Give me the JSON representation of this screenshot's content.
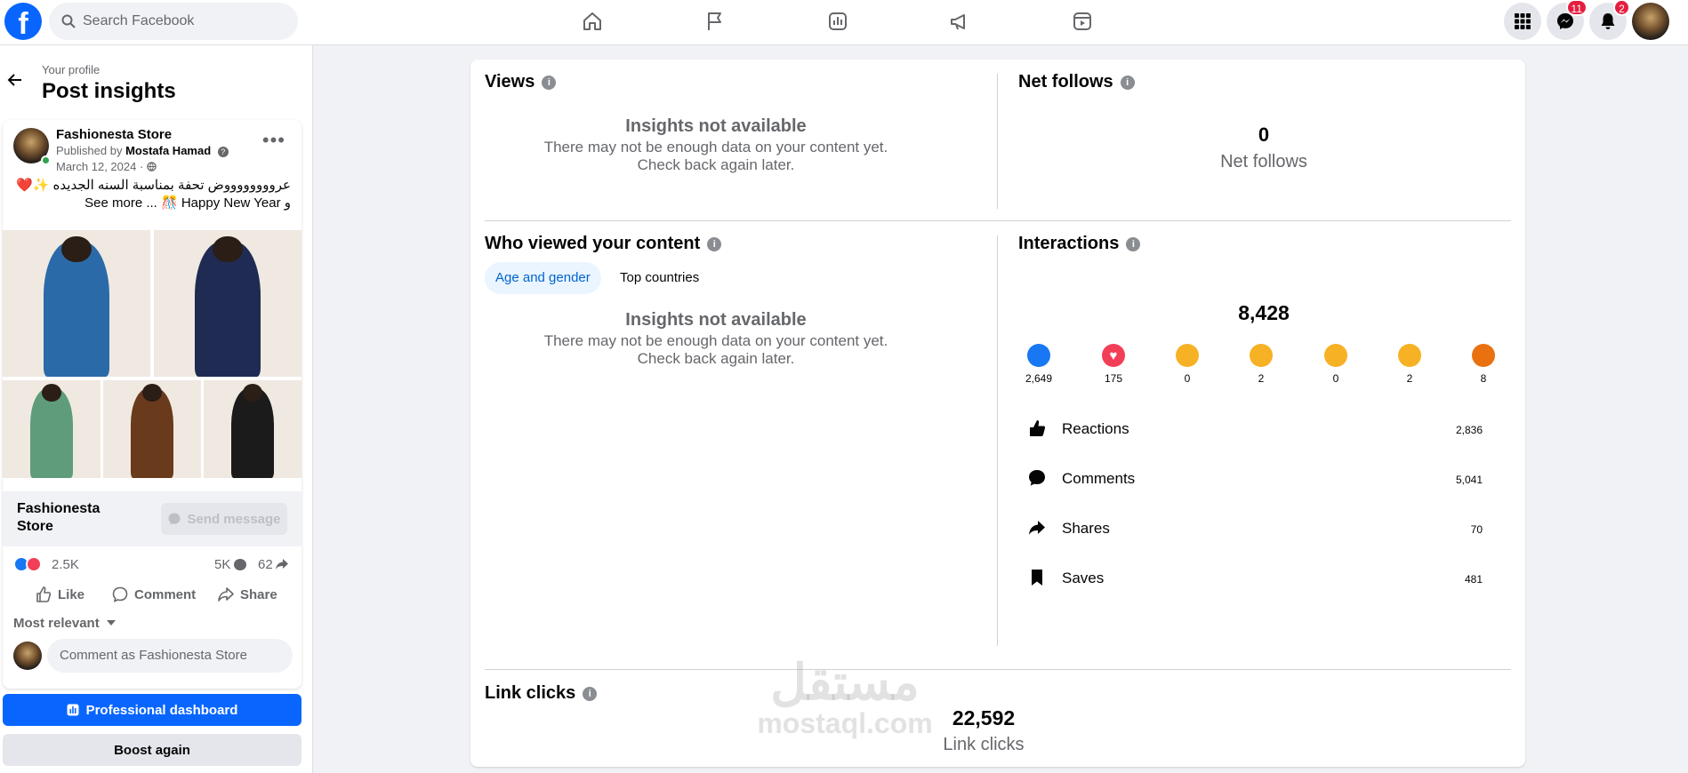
{
  "topbar": {
    "logo": "f",
    "search_placeholder": "Search Facebook",
    "nav_icons": [
      "home-icon",
      "pages-flag-icon",
      "insights-icon",
      "ads-megaphone-icon",
      "reels-icon"
    ],
    "menu_icon": "grid-menu-icon",
    "messenger_badge": "11",
    "notifications_badge": "2"
  },
  "left": {
    "breadcrumb": "Your profile",
    "title": "Post insights",
    "post": {
      "author": "Fashionesta Store",
      "published_prefix": "Published by",
      "publisher": "Mostafa Hamad",
      "date": "March 12, 2024 ·",
      "text_line1": "عرووووووووض تحفة بمناسبة السنه الجديده ✨❤️",
      "text_line2": "See more ... 🎊 Happy New Year و",
      "page_name": "Fashionesta Store",
      "send_message": "Send message",
      "reactions_count": "2.5K",
      "comments_count": "5K",
      "shares_count": "62",
      "like": "Like",
      "comment": "Comment",
      "share": "Share",
      "sort": "Most relevant",
      "comment_placeholder": "Comment as Fashionesta Store"
    },
    "professional_dashboard": "Professional dashboard",
    "boost_again": "Boost again"
  },
  "main": {
    "views": {
      "title": "Views",
      "na_title": "Insights not available",
      "na_sub": "There may not be enough data on your content yet. Check back again later."
    },
    "net_follows": {
      "title": "Net follows",
      "value": "0",
      "label": "Net follows"
    },
    "who_viewed": {
      "title": "Who viewed your content",
      "tabs": [
        "Age and gender",
        "Top countries"
      ],
      "na_title": "Insights not available",
      "na_sub": "There may not be enough data on your content yet. Check back again later."
    },
    "interactions": {
      "title": "Interactions",
      "total": "8,428",
      "reactions": [
        {
          "icon": "like-reaction-icon",
          "color": "#1877f2",
          "count": "2,649"
        },
        {
          "icon": "love-reaction-icon",
          "color": "#f33e58",
          "count": "175"
        },
        {
          "icon": "care-reaction-icon",
          "color": "#f7b125",
          "count": "0"
        },
        {
          "icon": "haha-reaction-icon",
          "color": "#f7b125",
          "count": "2"
        },
        {
          "icon": "wow-reaction-icon",
          "color": "#f7b125",
          "count": "0"
        },
        {
          "icon": "sad-reaction-icon",
          "color": "#f7b125",
          "count": "2"
        },
        {
          "icon": "angry-reaction-icon",
          "color": "#e9710f",
          "count": "8"
        }
      ],
      "rows": [
        {
          "label": "Reactions",
          "value": "2,836"
        },
        {
          "label": "Comments",
          "value": "5,041"
        },
        {
          "label": "Shares",
          "value": "70"
        },
        {
          "label": "Saves",
          "value": "481"
        }
      ]
    },
    "link_clicks": {
      "title": "Link clicks",
      "value": "22,592",
      "label": "Link clicks"
    }
  },
  "watermark": {
    "arabic": "مستقل",
    "latin": "mostaql.com"
  },
  "colors": {
    "brand": "#0866ff",
    "tab_active_bg": "#ebf5ff",
    "tab_active_text": "#0064d1"
  }
}
